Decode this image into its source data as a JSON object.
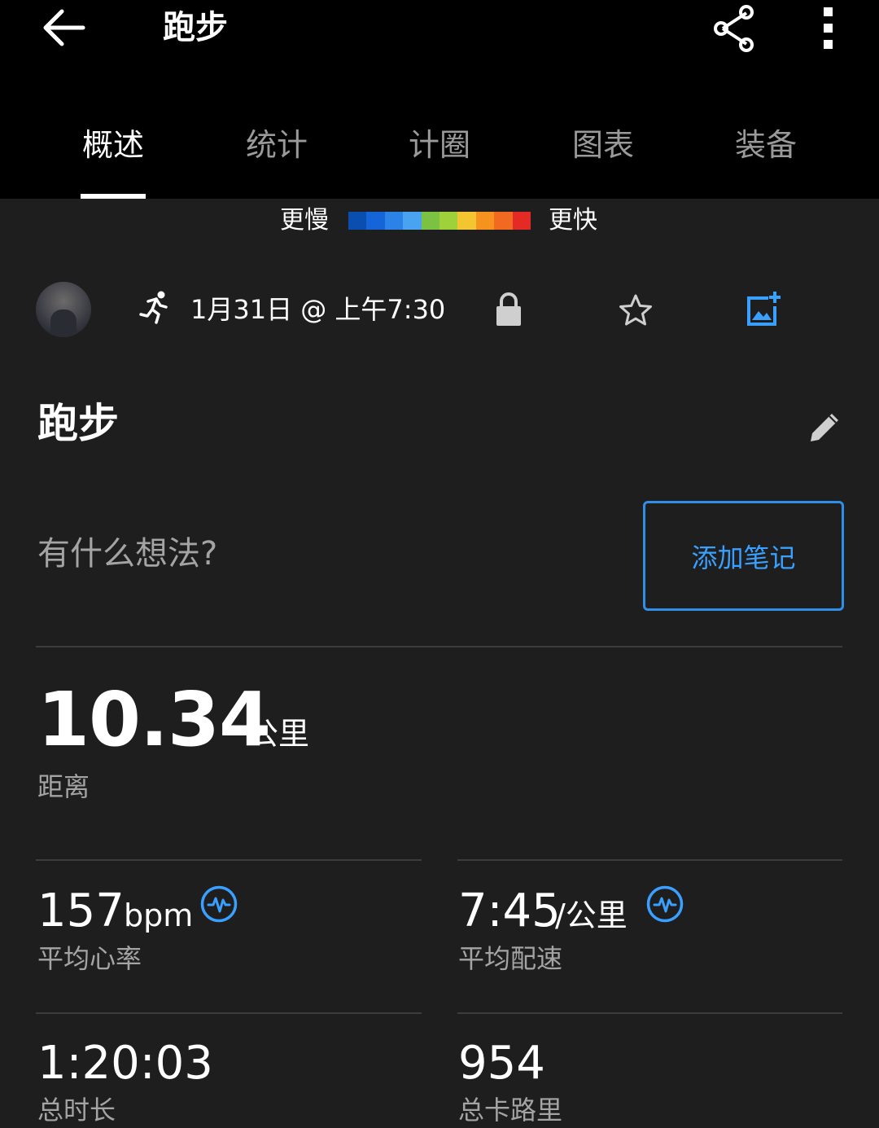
{
  "header": {
    "title": "跑步",
    "back_icon": "arrow-back-icon",
    "share_icon": "share-icon",
    "more_icon": "more-vert-icon"
  },
  "tabs": [
    {
      "label": "概述",
      "active": true
    },
    {
      "label": "统计",
      "active": false
    },
    {
      "label": "计圈",
      "active": false
    },
    {
      "label": "图表",
      "active": false
    },
    {
      "label": "装备",
      "active": false
    }
  ],
  "pace_legend": {
    "slow_label": "更慢",
    "fast_label": "更快",
    "colors": [
      "#0a4fb0",
      "#1565d8",
      "#2b83e8",
      "#4aa3f0",
      "#7cc242",
      "#9fd23a",
      "#f2c531",
      "#f6921e",
      "#f26a21",
      "#e42a25"
    ]
  },
  "activity": {
    "avatar_icon": "user-avatar",
    "type_icon": "running-icon",
    "date_time": "1月31日 @ 上午7:30",
    "privacy_icon": "lock-icon",
    "favorite_icon": "star-outline-icon",
    "add_photo_icon": "add-photo-icon",
    "name": "跑步",
    "edit_icon": "edit-icon",
    "note_prompt": "有什么想法?",
    "add_note_label": "添加笔记"
  },
  "summary": {
    "distance_value": "10.34",
    "distance_unit": "公里",
    "distance_label": "距离"
  },
  "stats": [
    {
      "value": "157",
      "unit": "bpm",
      "label": "平均心率",
      "badge_icon": "heart-rate-badge-icon"
    },
    {
      "value": "7:45",
      "unit": "/公里",
      "label": "平均配速",
      "badge_icon": "heart-rate-badge-icon"
    },
    {
      "value": "1:20:03",
      "unit": "",
      "label": "总时长"
    },
    {
      "value": "954",
      "unit": "",
      "label": "总卡路里"
    }
  ],
  "colors": {
    "accent": "#2f8fe8",
    "background": "#1e1e1f",
    "header_background": "#000000",
    "secondary_text": "#a4a4a4"
  }
}
